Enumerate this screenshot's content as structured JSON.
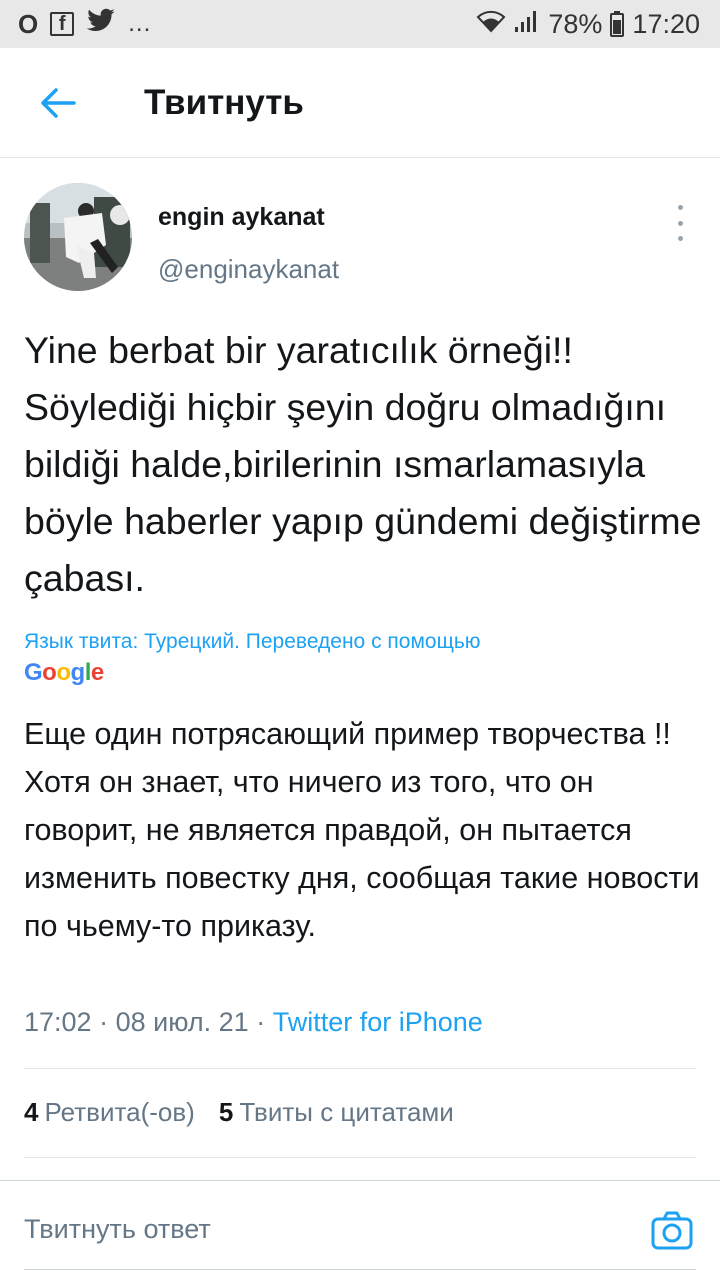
{
  "status_bar": {
    "left_icons": [
      "O",
      "f",
      "twitter-bird"
    ],
    "more": "...",
    "battery": "78%",
    "time": "17:20"
  },
  "header": {
    "title": "Твитнуть"
  },
  "tweet": {
    "author_name": "engin aykanat",
    "author_handle": "@enginaykanat",
    "text": "Yine berbat bir yaratıcılık örneği!! Söylediği hiçbir şeyin doğru olmadığını bildiği halde,birilerinin ısmarlamasıyla böyle haberler yapıp gündemi değiştirme çabası.",
    "translate_note": "Язык твита: Турецкий. Переведено с помощью",
    "translate_provider": "Google",
    "translation": "Еще один потрясающий пример творчества !! Хотя он знает, что ничего из того, что он говорит, не является правдой, он пытается изменить повестку дня, сообщая такие новости по чьему-то приказу.",
    "time": "17:02",
    "date": "08 июл. 21",
    "separator": "·",
    "source": "Twitter for iPhone"
  },
  "stats": {
    "retweets_count": "4",
    "retweets_label": "Ретвита(-ов)",
    "quotes_count": "5",
    "quotes_label": "Твиты с цитатами"
  },
  "reply": {
    "placeholder": "Твитнуть ответ"
  },
  "colors": {
    "accent": "#1da1f2",
    "secondary_text": "#657786",
    "status_bar_bg": "#e8e8e8"
  }
}
